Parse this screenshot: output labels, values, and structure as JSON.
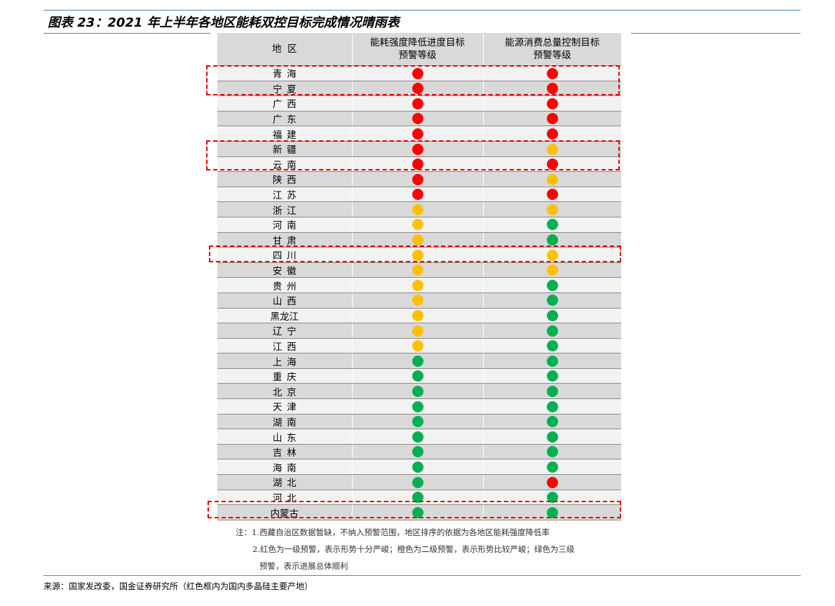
{
  "title": "图表 23：2021 年上半年各地区能耗双控目标完成情况晴雨表",
  "table": {
    "headers": {
      "region": "地  区",
      "col1_line1": "能耗强度降低进度目标",
      "col1_line2": "预警等级",
      "col2_line1": "能源消费总量控制目标",
      "col2_line2": "预警等级"
    },
    "colors": {
      "red": "#ff0000",
      "orange": "#ffc000",
      "green": "#00b050"
    },
    "rows": [
      {
        "region": "青海",
        "intensity": "red",
        "total": "red"
      },
      {
        "region": "宁夏",
        "intensity": "red",
        "total": "red"
      },
      {
        "region": "广西",
        "intensity": "red",
        "total": "red"
      },
      {
        "region": "广东",
        "intensity": "red",
        "total": "red"
      },
      {
        "region": "福建",
        "intensity": "red",
        "total": "red"
      },
      {
        "region": "新疆",
        "intensity": "red",
        "total": "orange"
      },
      {
        "region": "云南",
        "intensity": "red",
        "total": "red"
      },
      {
        "region": "陕西",
        "intensity": "red",
        "total": "orange"
      },
      {
        "region": "江苏",
        "intensity": "red",
        "total": "red"
      },
      {
        "region": "浙江",
        "intensity": "orange",
        "total": "orange"
      },
      {
        "region": "河南",
        "intensity": "orange",
        "total": "green"
      },
      {
        "region": "甘肃",
        "intensity": "orange",
        "total": "green"
      },
      {
        "region": "四川",
        "intensity": "orange",
        "total": "orange"
      },
      {
        "region": "安徽",
        "intensity": "orange",
        "total": "orange"
      },
      {
        "region": "贵州",
        "intensity": "orange",
        "total": "green"
      },
      {
        "region": "山西",
        "intensity": "orange",
        "total": "green"
      },
      {
        "region": "黑龙江",
        "intensity": "orange",
        "total": "green"
      },
      {
        "region": "辽宁",
        "intensity": "orange",
        "total": "green"
      },
      {
        "region": "江西",
        "intensity": "orange",
        "total": "green"
      },
      {
        "region": "上海",
        "intensity": "green",
        "total": "green"
      },
      {
        "region": "重庆",
        "intensity": "green",
        "total": "green"
      },
      {
        "region": "北京",
        "intensity": "green",
        "total": "green"
      },
      {
        "region": "天津",
        "intensity": "green",
        "total": "green"
      },
      {
        "region": "湖南",
        "intensity": "green",
        "total": "green"
      },
      {
        "region": "山东",
        "intensity": "green",
        "total": "green"
      },
      {
        "region": "吉林",
        "intensity": "green",
        "total": "green"
      },
      {
        "region": "海南",
        "intensity": "green",
        "total": "green"
      },
      {
        "region": "湖北",
        "intensity": "green",
        "total": "red"
      },
      {
        "region": "河北",
        "intensity": "green",
        "total": "green"
      },
      {
        "region": "内蒙古",
        "intensity": "green",
        "total": "green"
      }
    ],
    "highlight_color": "#e00000"
  },
  "notes": {
    "line1": "注：1.西藏自治区数据暂缺，不纳入预警范围，地区排序的依据为各地区能耗强度降低率",
    "line2": "2.红色为一级预警，表示形势十分严峻；橙色为二级预警，表示形势比较严峻；绿色为三级",
    "line3": "预警，表示进展总体顺利"
  },
  "footer": "来源：国家发改委，国金证券研究所（红色框内为国内多晶硅主要产地）"
}
